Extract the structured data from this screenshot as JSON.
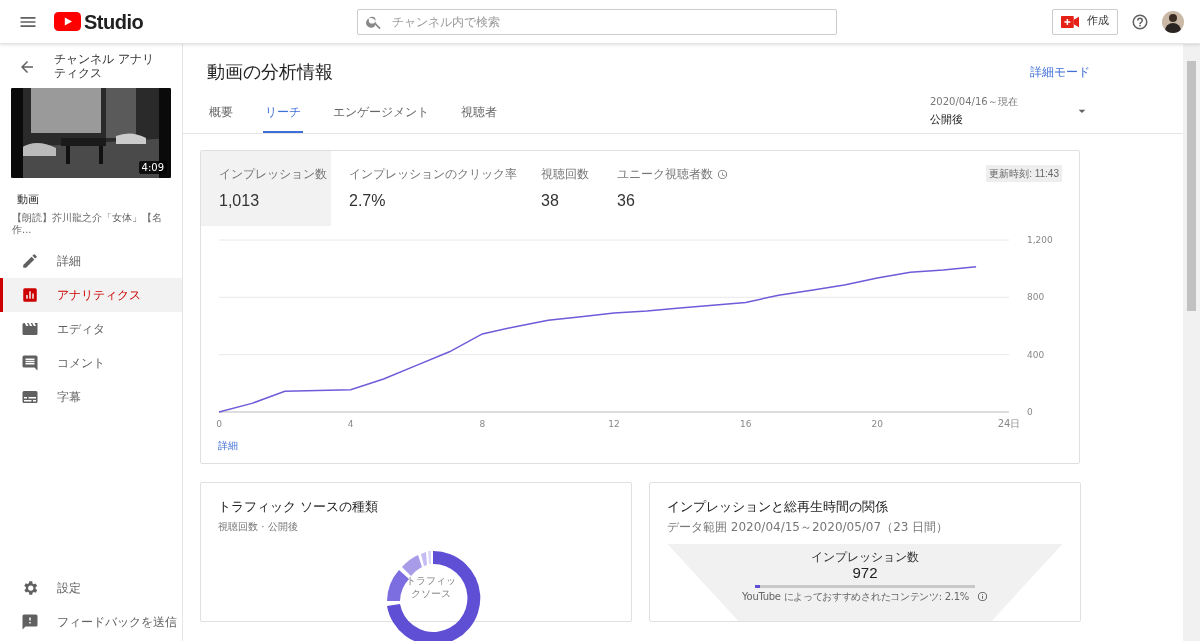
{
  "header": {
    "logo_text": "Studio",
    "search": {
      "placeholder": "チャンネル内で検索"
    },
    "create_button": "作成"
  },
  "sidebar": {
    "back_label": "チャンネル アナリティクス",
    "video": {
      "duration": "4:09",
      "section_label": "動画",
      "title": "【朗読】芥川龍之介「女体」【名作..."
    },
    "items": [
      {
        "label": "詳細",
        "kind": "pencil",
        "selected": false
      },
      {
        "label": "アナリティクス",
        "kind": "analytics",
        "selected": true
      },
      {
        "label": "エディタ",
        "kind": "clapper",
        "selected": false
      },
      {
        "label": "コメント",
        "kind": "comment",
        "selected": false
      },
      {
        "label": "字幕",
        "kind": "subtitles",
        "selected": false
      }
    ],
    "bottom_items": [
      {
        "label": "設定",
        "kind": "gear"
      },
      {
        "label": "フィードバックを送信",
        "kind": "feedback"
      }
    ]
  },
  "main": {
    "title": "動画の分析情報",
    "advanced_mode_link": "詳細モード",
    "tabs": [
      {
        "label": "概要",
        "selected": false
      },
      {
        "label": "リーチ",
        "selected": true
      },
      {
        "label": "エンゲージメント",
        "selected": false
      },
      {
        "label": "視聴者",
        "selected": false
      }
    ],
    "date_range": {
      "range": "2020/04/16～現在",
      "label": "公開後"
    },
    "metrics": [
      {
        "label": "インプレッション数",
        "value": "1,013",
        "selected": true,
        "realtime": false
      },
      {
        "label": "インプレッションのクリック率",
        "value": "2.7%",
        "selected": false,
        "realtime": false
      },
      {
        "label": "視聴回数",
        "value": "38",
        "selected": false,
        "realtime": false
      },
      {
        "label": "ユニーク視聴者数",
        "value": "36",
        "selected": false,
        "realtime": true
      }
    ],
    "updated": "更新時刻: 11:43",
    "chart_data": {
      "type": "line",
      "x": [
        0,
        1,
        2,
        3,
        4,
        5,
        6,
        7,
        8,
        9,
        10,
        11,
        12,
        13,
        14,
        15,
        16,
        17,
        18,
        19,
        20,
        21,
        22,
        23
      ],
      "series": [
        {
          "color": "#6f5bd9",
          "values": [
            0,
            60,
            145,
            150,
            155,
            230,
            325,
            420,
            545,
            595,
            640,
            665,
            690,
            705,
            725,
            745,
            765,
            815,
            850,
            885,
            935,
            975,
            990,
            1013
          ]
        }
      ],
      "xlim": [
        0,
        24
      ],
      "ylim": [
        0,
        1200
      ],
      "xticks": [
        0,
        4,
        8,
        12,
        16,
        20,
        {
          "value": 24,
          "label": "24日"
        }
      ],
      "yticks": [
        0,
        400,
        800,
        {
          "value": 1200,
          "label": "1,200"
        }
      ]
    },
    "details_link": "詳細",
    "traffic_card": {
      "title": "トラフィック ソースの種類",
      "subtitle": "視聴回数 · 公開後",
      "donut_label": "トラフィックソース"
    },
    "funnel_card": {
      "title": "インプレッションと総再生時間の関係",
      "subtitle": "データ範囲 2020/04/15～2020/05/07（23 日間）",
      "metric_label": "インプレッション数",
      "metric_value": "972",
      "level": 0.021,
      "note": "YouTube によっておすすめされたコンテンツ: 2.1%"
    }
  }
}
